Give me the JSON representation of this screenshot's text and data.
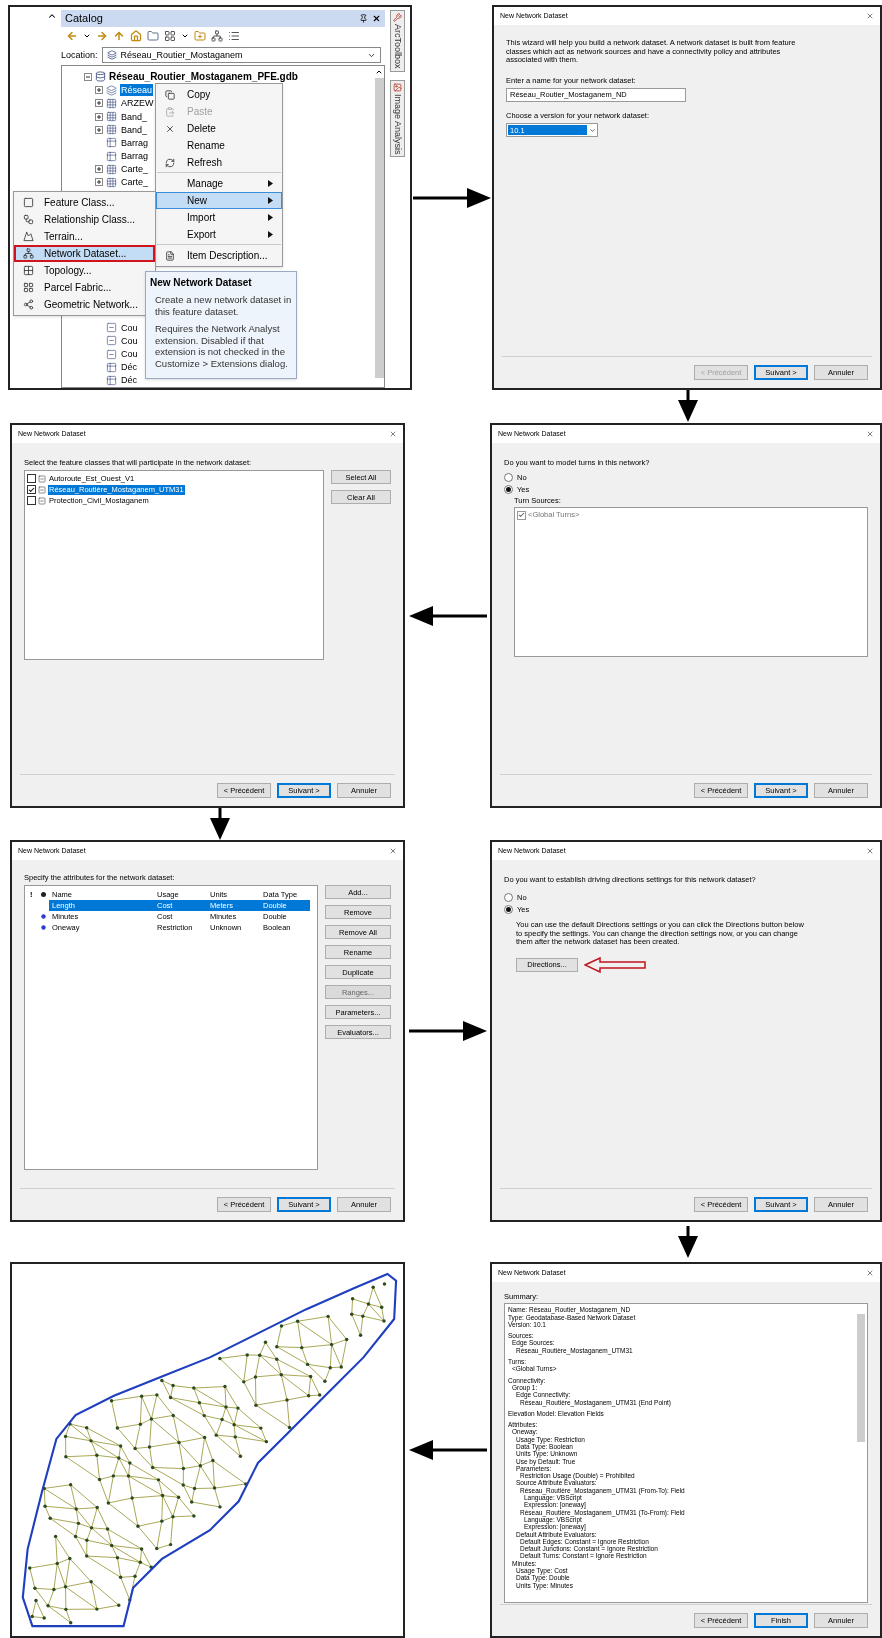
{
  "catalog": {
    "title": "Catalog",
    "location_label": "Location:",
    "location_value": "Réseau_Routier_Mostaganem",
    "side_tabs": [
      "ArcToolbox",
      "Image Analysis"
    ],
    "tree": {
      "label": "Réseau_Routier_Mostaganem_PFE.gdb",
      "expanded": true,
      "children": [
        {
          "label": "Réseau",
          "kind": "dataset",
          "collapsed": true,
          "selected": true
        },
        {
          "label": "ARZEW",
          "kind": "raster",
          "collapsed": true,
          "selected": false
        },
        {
          "label": "Band_",
          "kind": "raster",
          "collapsed": true,
          "selected": false
        },
        {
          "label": "Band_",
          "kind": "raster",
          "collapsed": true,
          "selected": false
        },
        {
          "label": "Barrag",
          "kind": "table",
          "collapsed": false,
          "selected": false
        },
        {
          "label": "Barrag",
          "kind": "table",
          "collapsed": false,
          "selected": false
        },
        {
          "label": "Carte_",
          "kind": "raster",
          "collapsed": true,
          "selected": false
        },
        {
          "label": "Carte_",
          "kind": "raster",
          "collapsed": true,
          "selected": false
        }
      ],
      "children_below": [
        {
          "label": "Cou",
          "kind": "line",
          "collapsed": false,
          "selected": false
        },
        {
          "label": "Cou",
          "kind": "line",
          "collapsed": false,
          "selected": false
        },
        {
          "label": "Cou",
          "kind": "line",
          "collapsed": false,
          "selected": false
        },
        {
          "label": "Déc",
          "kind": "table",
          "collapsed": false,
          "selected": false
        },
        {
          "label": "Déc",
          "kind": "table",
          "collapsed": false,
          "selected": false
        }
      ]
    },
    "context_menu": [
      {
        "label": "Copy",
        "disabled": false,
        "submenu": false,
        "selected": false,
        "separator_before": false
      },
      {
        "label": "Paste",
        "disabled": true,
        "submenu": false,
        "selected": false,
        "separator_before": false
      },
      {
        "label": "Delete",
        "disabled": false,
        "submenu": false,
        "selected": false,
        "separator_before": false
      },
      {
        "label": "Rename",
        "disabled": false,
        "submenu": false,
        "selected": false,
        "separator_before": false
      },
      {
        "label": "Refresh",
        "disabled": false,
        "submenu": false,
        "selected": false,
        "separator_before": false
      },
      {
        "label": "Manage",
        "disabled": false,
        "submenu": true,
        "selected": false,
        "separator_before": true
      },
      {
        "label": "New",
        "disabled": false,
        "submenu": true,
        "selected": true,
        "separator_before": false
      },
      {
        "label": "Import",
        "disabled": false,
        "submenu": true,
        "selected": false,
        "separator_before": false
      },
      {
        "label": "Export",
        "disabled": false,
        "submenu": true,
        "selected": false,
        "separator_before": false
      },
      {
        "label": "Item Description...",
        "disabled": false,
        "submenu": false,
        "selected": false,
        "separator_before": true
      }
    ],
    "new_menu": [
      {
        "label": "Feature Class...",
        "selected": false,
        "outlined": false
      },
      {
        "label": "Relationship Class...",
        "selected": false,
        "outlined": false
      },
      {
        "label": "Terrain...",
        "selected": false,
        "outlined": false
      },
      {
        "label": "Network Dataset...",
        "selected": true,
        "outlined": true
      },
      {
        "label": "Topology...",
        "selected": false,
        "outlined": false
      },
      {
        "label": "Parcel Fabric...",
        "selected": false,
        "outlined": false
      },
      {
        "label": "Geometric Network...",
        "selected": false,
        "outlined": false
      }
    ],
    "tooltip": {
      "title": "New Network Dataset",
      "paragraphs": [
        "Create a new network dataset in this feature dataset.",
        "Requires the Network Analyst extension. Disabled if that extension is not checked in the Customize > Extensions dialog."
      ]
    }
  },
  "wizard_name": {
    "title": "New Network Dataset",
    "intro": "This wizard will help you build a network dataset. A network dataset is built from feature classes which act as network sources and have a connectivity policy and attributes associated with them.",
    "name_label": "Enter a name for your network dataset:",
    "name_value": "Réseau_Routier_Mostaganem_ND",
    "version_label": "Choose a version for your network dataset:",
    "version_value": "10.1",
    "buttons": [
      {
        "label": "< Précédent",
        "disabled": true,
        "default": false
      },
      {
        "label": "Suivant >",
        "disabled": false,
        "default": true
      },
      {
        "label": "Annuler",
        "disabled": false,
        "default": false
      }
    ]
  },
  "wizard_sources": {
    "title": "New Network Dataset",
    "instruction": "Select the feature classes that will participate in the network dataset:",
    "items": [
      {
        "label": "Autoroute_Est_Ouest_V1",
        "checked": false,
        "selected": false
      },
      {
        "label": "Réseau_Routière_Mostaganem_UTM31",
        "checked": true,
        "selected": true
      },
      {
        "label": "Protection_Civil_Mostaganem",
        "checked": false,
        "selected": false
      }
    ],
    "side_buttons": [
      "Select All",
      "Clear All"
    ],
    "buttons": [
      {
        "label": "< Précédent",
        "disabled": false,
        "default": false
      },
      {
        "label": "Suivant >",
        "disabled": false,
        "default": true
      },
      {
        "label": "Annuler",
        "disabled": false,
        "default": false
      }
    ]
  },
  "wizard_turns": {
    "title": "New Network Dataset",
    "question": "Do you want to model turns in this network?",
    "options": [
      {
        "label": "No",
        "selected": false
      },
      {
        "label": "Yes",
        "selected": true
      }
    ],
    "sources_label": "Turn Sources:",
    "sources": [
      {
        "label": "<Global Turns>",
        "checked": true,
        "disabled": true
      }
    ],
    "buttons": [
      {
        "label": "< Précédent",
        "disabled": false,
        "default": false
      },
      {
        "label": "Suivant >",
        "disabled": false,
        "default": true
      },
      {
        "label": "Annuler",
        "disabled": false,
        "default": false
      }
    ]
  },
  "wizard_attributes": {
    "title": "New Network Dataset",
    "instruction": "Specify the attributes for the network dataset:",
    "columns": [
      "!",
      "Name",
      "Usage",
      "Units",
      "Data Type"
    ],
    "rows": [
      {
        "name": "Length",
        "usage": "Cost",
        "units": "Meters",
        "data_type": "Double",
        "default": false,
        "selected": true
      },
      {
        "name": "Minutes",
        "usage": "Cost",
        "units": "Minutes",
        "data_type": "Double",
        "default": true,
        "selected": false
      },
      {
        "name": "Oneway",
        "usage": "Restriction",
        "units": "Unknown",
        "data_type": "Boolean",
        "default": true,
        "selected": false
      }
    ],
    "side_buttons": [
      {
        "label": "Add...",
        "disabled": false
      },
      {
        "label": "Remove",
        "disabled": false
      },
      {
        "label": "Remove All",
        "disabled": false
      },
      {
        "label": "Rename",
        "disabled": false
      },
      {
        "label": "Duplicate",
        "disabled": false
      },
      {
        "label": "Ranges...",
        "disabled": true
      },
      {
        "label": "Parameters...",
        "disabled": false
      },
      {
        "label": "Evaluators...",
        "disabled": false
      }
    ],
    "buttons": [
      {
        "label": "< Précédent",
        "disabled": false,
        "default": false
      },
      {
        "label": "Suivant >",
        "disabled": false,
        "default": true
      },
      {
        "label": "Annuler",
        "disabled": false,
        "default": false
      }
    ]
  },
  "wizard_directions": {
    "title": "New Network Dataset",
    "question": "Do you want to establish driving directions settings for this network dataset?",
    "options": [
      {
        "label": "No",
        "selected": false
      },
      {
        "label": "Yes",
        "selected": true
      }
    ],
    "note": "You can use the default Directions settings or you can click the Directions button below to specify the settings. You can change the direction settings now, or you can change them after the network dataset has been created.",
    "directions_button": "Directions...",
    "buttons": [
      {
        "label": "< Précédent",
        "disabled": false,
        "default": false
      },
      {
        "label": "Suivant >",
        "disabled": false,
        "default": true
      },
      {
        "label": "Annuler",
        "disabled": false,
        "default": false
      }
    ]
  },
  "wizard_summary": {
    "title": "New Network Dataset",
    "label": "Summary:",
    "groups": [
      [
        {
          "text": "Name: Réseau_Routier_Mostaganem_ND"
        },
        {
          "text": "Type: Geodatabase-Based Network Dataset"
        },
        {
          "text": "Version: 10.1"
        }
      ],
      [
        {
          "text": "Sources:",
          "children": [
            {
              "text": "Edge Sources:",
              "children": [
                {
                  "text": "Réseau_Routière_Mostaganem_UTM31"
                }
              ]
            }
          ]
        }
      ],
      [
        {
          "text": "Turns:",
          "children": [
            {
              "text": "<Global Turns>"
            }
          ]
        }
      ],
      [
        {
          "text": "Connectivity:",
          "children": [
            {
              "text": "Group 1:",
              "children": [
                {
                  "text": "Edge Connectivity:",
                  "children": [
                    {
                      "text": "Réseau_Routière_Mostaganem_UTM31 (End Point)"
                    }
                  ]
                }
              ]
            }
          ]
        }
      ],
      [
        {
          "text": "Elevation Model: Elevation Fields"
        }
      ],
      [
        {
          "text": "Attributes:",
          "children": [
            {
              "text": "Oneway:",
              "children": [
                {
                  "text": "Usage Type: Restriction"
                },
                {
                  "text": "Data Type: Boolean"
                },
                {
                  "text": "Units Type: Unknown"
                },
                {
                  "text": "Use by Default: True"
                },
                {
                  "text": "Parameters:",
                  "children": [
                    {
                      "text": "Restriction Usage (Double) = Prohibited"
                    }
                  ]
                },
                {
                  "text": "Source Attribute Evaluators:",
                  "children": [
                    {
                      "text": "Réseau_Routière_Mostaganem_UTM31 (From-To): Field",
                      "children": [
                        {
                          "text": "Language: VBScript"
                        },
                        {
                          "text": "Expression: [oneway]"
                        }
                      ]
                    },
                    {
                      "text": "Réseau_Routière_Mostaganem_UTM31 (To-From): Field",
                      "children": [
                        {
                          "text": "Language: VBScript"
                        },
                        {
                          "text": "Expression: [oneway]"
                        }
                      ]
                    }
                  ]
                },
                {
                  "text": "Default Attribute Evaluators:",
                  "children": [
                    {
                      "text": "Default Edges: Constant = Ignore Restriction"
                    },
                    {
                      "text": "Default Junctions: Constant = Ignore Restriction"
                    },
                    {
                      "text": "Default Turns: Constant = Ignore Restriction"
                    }
                  ]
                }
              ]
            },
            {
              "text": "Minutes:",
              "children": [
                {
                  "text": "Usage Type: Cost"
                },
                {
                  "text": "Data Type: Double"
                },
                {
                  "text": "Units Type: Minutes"
                }
              ]
            }
          ]
        }
      ]
    ],
    "buttons": [
      {
        "label": "< Précédent",
        "disabled": false,
        "default": false
      },
      {
        "label": "Finish",
        "disabled": false,
        "default": true
      },
      {
        "label": "Annuler",
        "disabled": false,
        "default": false
      }
    ]
  }
}
